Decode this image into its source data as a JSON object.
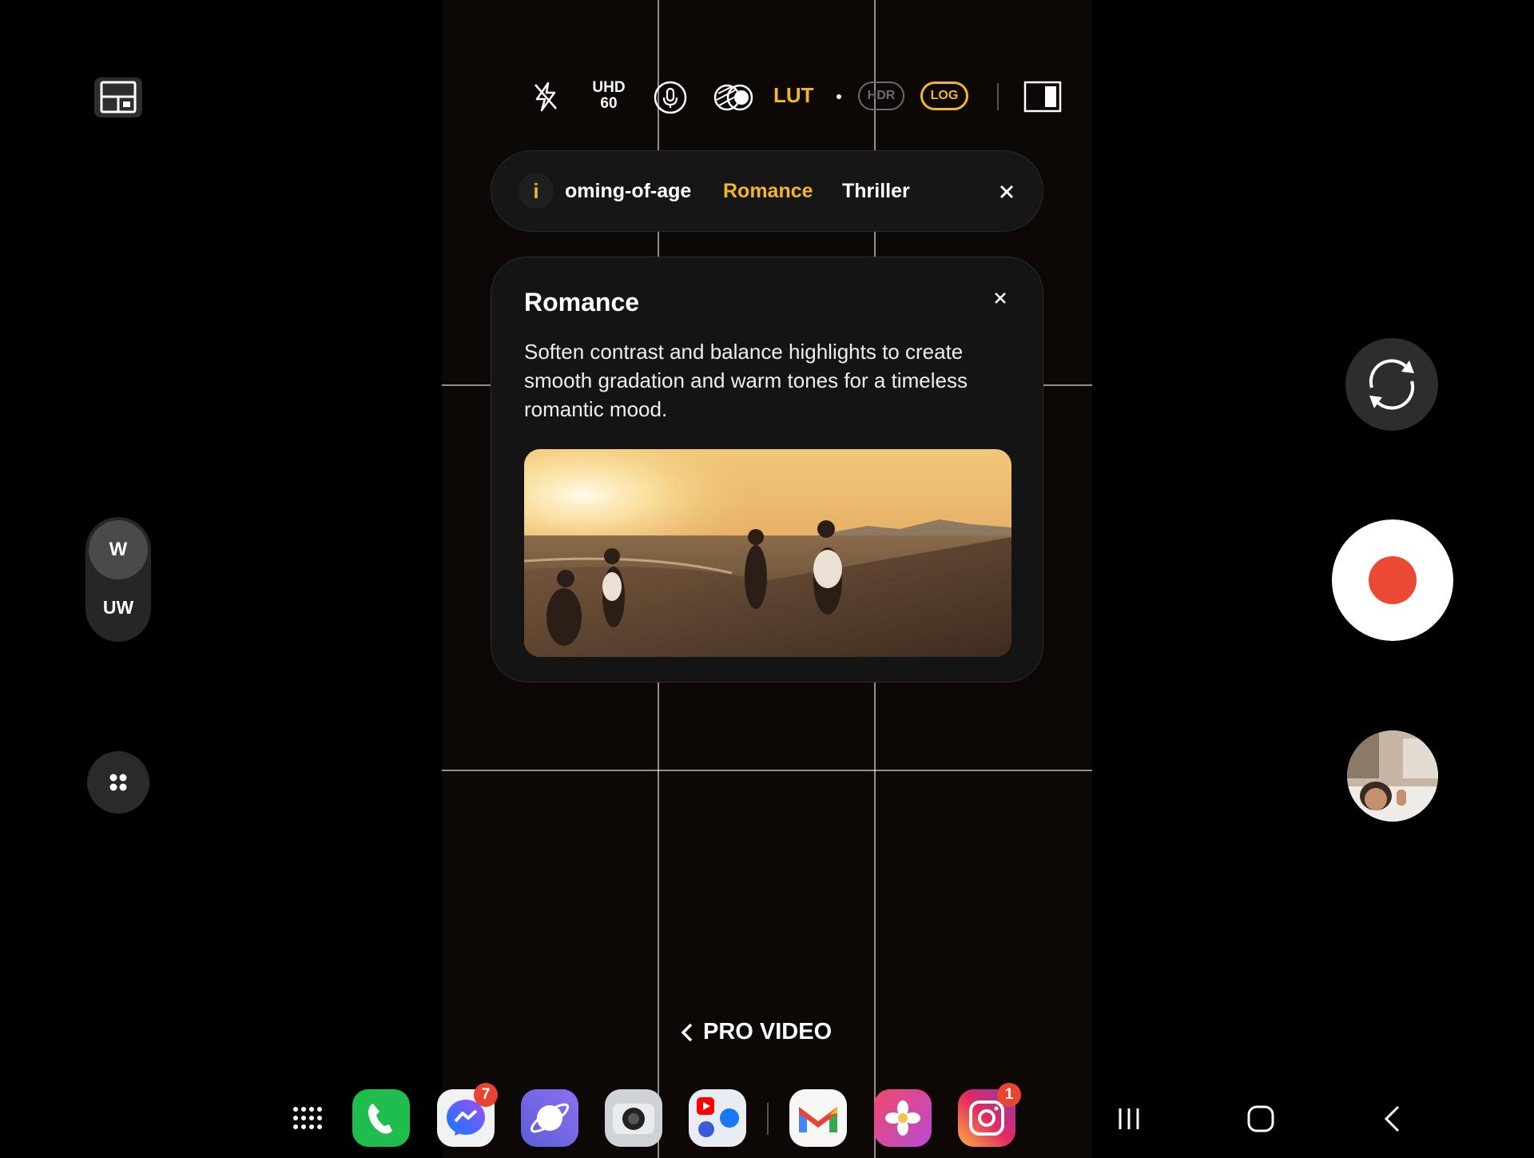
{
  "topbar": {
    "resolution_line1": "UHD",
    "resolution_line2": "60",
    "lut_label": "LUT",
    "hdr_label": "HDR",
    "log_label": "LOG",
    "icons": [
      "layout-icon",
      "flash-off-icon",
      "microphone-icon",
      "filter-icon",
      "aspect-ratio-icon"
    ]
  },
  "filters": {
    "info_label": "i",
    "items": [
      "oming-of-age",
      "Romance",
      "Thriller"
    ],
    "selected": "Romance",
    "accent_color": "#f2b629"
  },
  "info_card": {
    "title": "Romance",
    "description": "Soften contrast and balance highlights to create smooth gradation and warm tones for a timeless romantic mood.",
    "image": "beach-sunset-photo"
  },
  "lens": {
    "wide": "W",
    "ultra_wide": "UW",
    "selected": "W"
  },
  "mode": {
    "label": "PRO VIDEO"
  },
  "record": {
    "color": "#eb4934"
  },
  "dock": {
    "apps": [
      {
        "name": "phone",
        "badge": ""
      },
      {
        "name": "messenger",
        "badge": "7"
      },
      {
        "name": "internet",
        "badge": ""
      },
      {
        "name": "camera",
        "badge": ""
      },
      {
        "name": "social-folder",
        "badge": ""
      },
      {
        "name": "gmail",
        "badge": ""
      },
      {
        "name": "gallery",
        "badge": ""
      },
      {
        "name": "instagram",
        "badge": "1"
      }
    ]
  }
}
